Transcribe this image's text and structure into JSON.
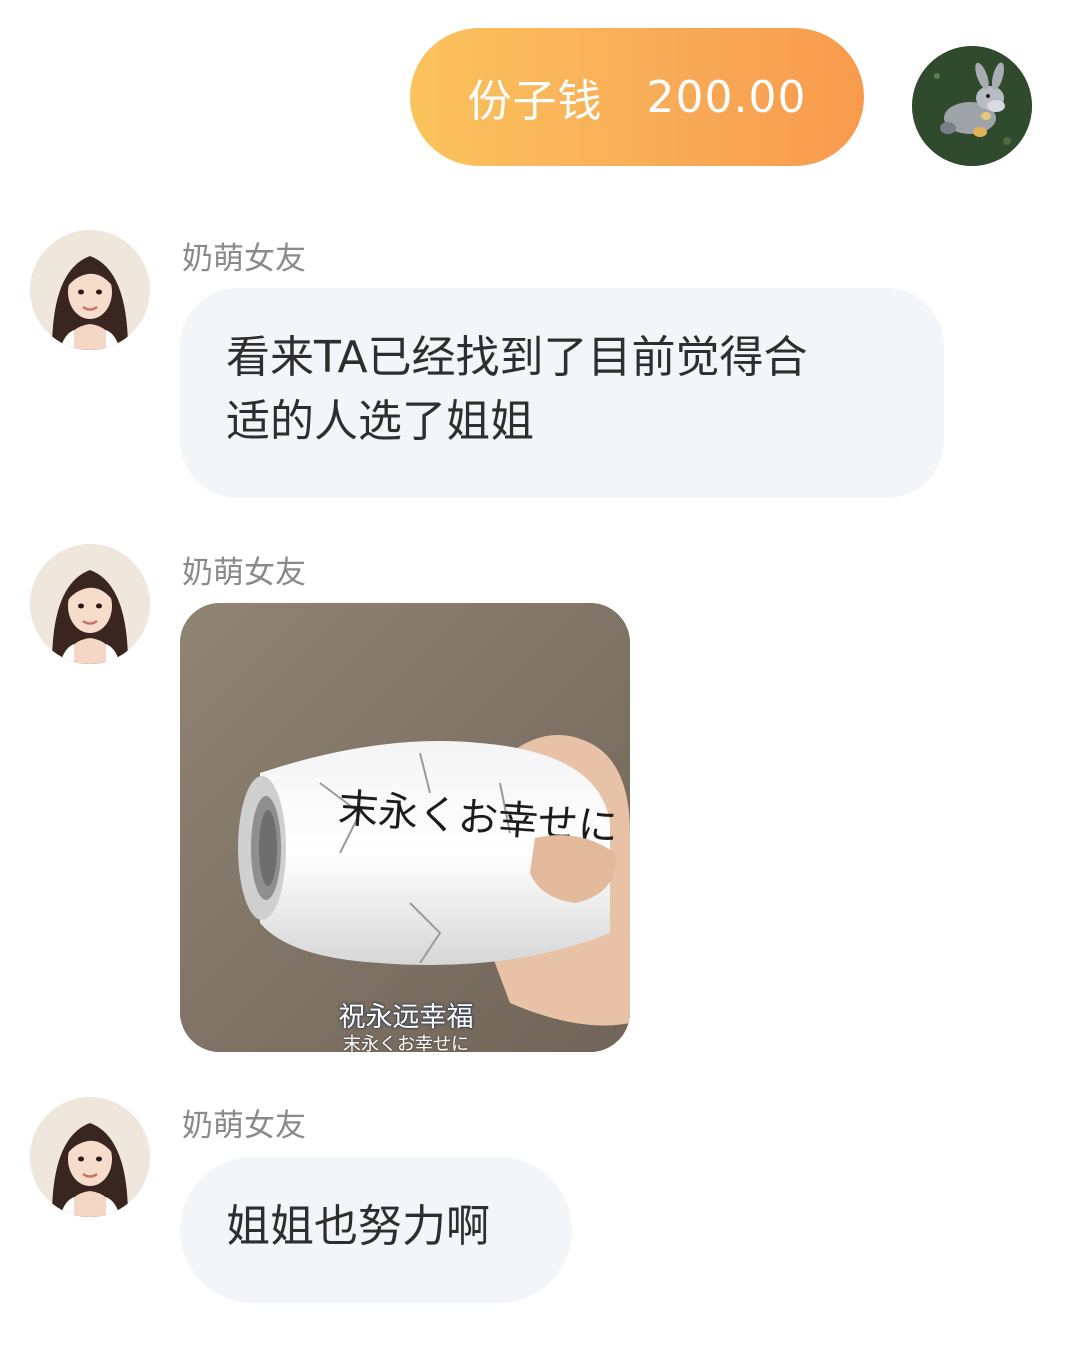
{
  "packet": {
    "label": "份子钱",
    "amount": "200.00",
    "gradient_start": "#fbc35c",
    "gradient_end": "#f79a4c"
  },
  "self_avatar": {
    "icon": "plush-toy-avatar"
  },
  "messages": [
    {
      "sender": "奶萌女友",
      "type": "text",
      "lines": [
        "看来TA已经找到了目前觉得合",
        "适的人选了姐姐"
      ]
    },
    {
      "sender": "奶萌女友",
      "type": "sticker",
      "sticker": {
        "can_text": "末永くお幸せに",
        "subtitle_cn": "祝永远幸福",
        "subtitle_jp": "末永くお幸せに"
      }
    },
    {
      "sender": "奶萌女友",
      "type": "text",
      "lines": [
        "姐姐也努力啊"
      ]
    }
  ],
  "colors": {
    "bubble_bg": "#f4f5f9",
    "sender_name": "#8a8a8a",
    "message_text": "#2e2e2e"
  }
}
